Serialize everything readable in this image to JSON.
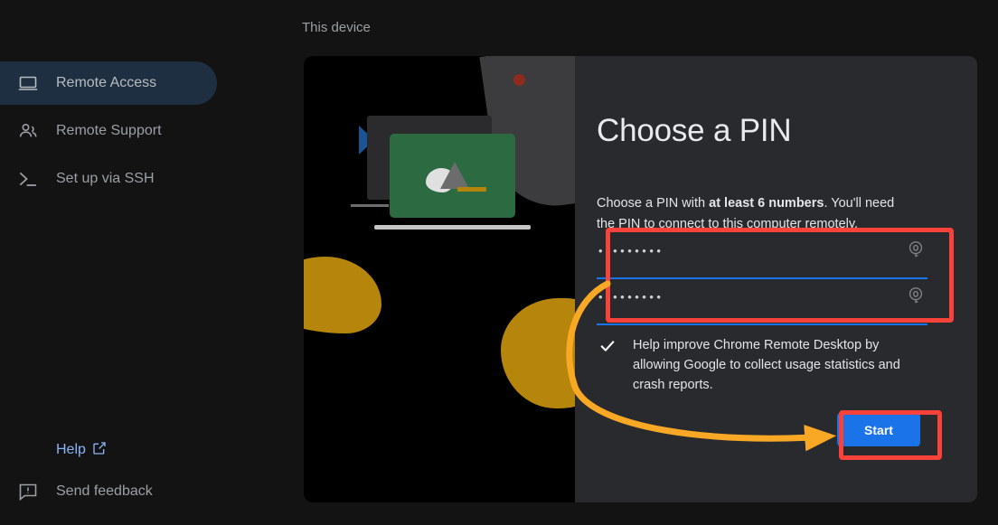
{
  "sidebar": {
    "items": [
      {
        "label": "Remote Access",
        "icon": "laptop-icon",
        "active": true
      },
      {
        "label": "Remote Support",
        "icon": "people-icon",
        "active": false
      },
      {
        "label": "Set up via SSH",
        "icon": "terminal-icon",
        "active": false
      }
    ],
    "footer": {
      "help_label": "Help",
      "help_icon": "external-link-icon",
      "feedback_label": "Send feedback",
      "feedback_icon": "feedback-icon"
    }
  },
  "main": {
    "section_label": "This device",
    "pin": {
      "title": "Choose a PIN",
      "description_prefix": "Choose a PIN with ",
      "description_bold": "at least 6 numbers",
      "description_suffix": ". You'll need the PIN to connect to this computer remotely.",
      "field_1_value": "•••••••••",
      "field_2_value": "•••••••••",
      "field_lock_icon": "password-manager-key-icon"
    },
    "checkbox": {
      "checked": true,
      "label": "Help improve Chrome Remote Desktop by allowing Google to collect usage statistics and crash reports."
    },
    "start_label": "Start"
  },
  "colors": {
    "accent_blue": "#1a73e8",
    "link_blue": "#8ab4f8",
    "highlight_red": "#f9423a",
    "arrow_orange": "#f9a825",
    "card_bg": "#292a2d",
    "page_bg": "#131314",
    "active_nav_bg": "#1e2f41",
    "illustration_green": "#2c6b41",
    "illustration_gold": "#b5860b"
  },
  "annotations": {
    "pin_highlight": "red-rectangle-around-pin-fields",
    "start_highlight": "red-rectangle-around-start-button",
    "arrow": "orange-curved-arrow-to-start-button"
  }
}
